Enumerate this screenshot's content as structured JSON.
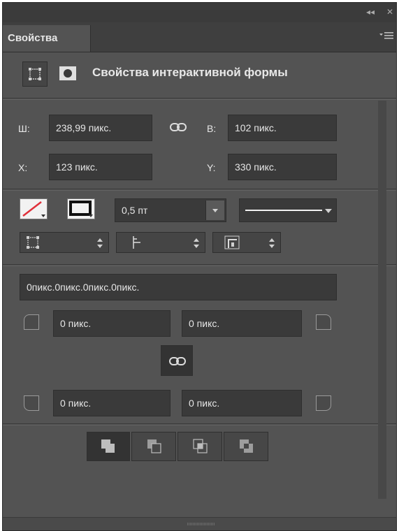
{
  "panel": {
    "tab_title": "Свойства",
    "header_title": "Свойства интерактивной формы"
  },
  "dimensions": {
    "width_label": "Ш:",
    "width_value": "238,99 пикс.",
    "height_label": "В:",
    "height_value": "102 пикс.",
    "x_label": "X:",
    "x_value": "123 пикс.",
    "y_label": "Y:",
    "y_value": "330 пикс."
  },
  "stroke": {
    "width_value": "0,5 пт"
  },
  "corners": {
    "combined_value": "0пикс.0пикс.0пикс.0пикс.",
    "top_left": "0 пикс.",
    "top_right": "0 пикс.",
    "bottom_left": "0 пикс.",
    "bottom_right": "0 пикс."
  },
  "colors": {
    "panel_bg": "#535353",
    "field_bg": "#3a3a3a",
    "text": "#e6e6e6",
    "fill_none_slash": "#e0303a"
  },
  "icons": [
    "collapse-icon",
    "close-icon",
    "panel-menu-icon",
    "shape-properties-icon",
    "mask-properties-icon",
    "link-icon",
    "fill-swatch-icon",
    "stroke-swatch-icon",
    "stroke-align-icon",
    "stroke-caps-icon",
    "stroke-corners-icon",
    "corner-icon",
    "combine-shapes-icon",
    "subtract-front-icon",
    "intersect-icon",
    "exclude-overlap-icon",
    "resize-grip-icon"
  ]
}
